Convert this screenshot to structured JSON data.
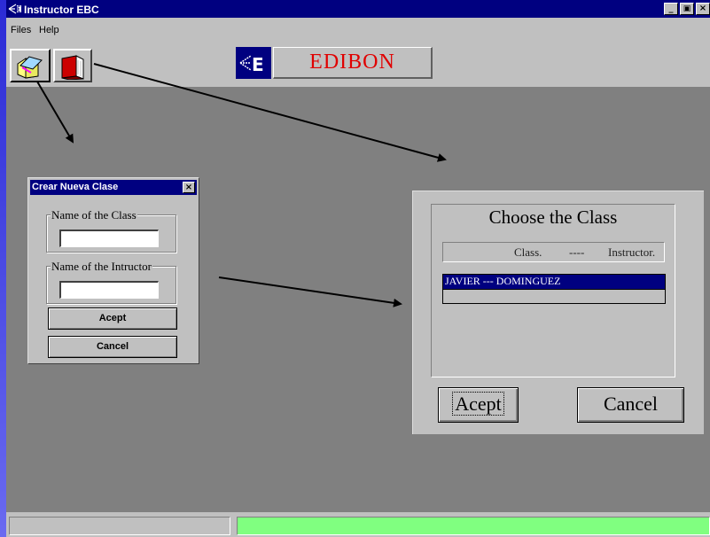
{
  "window": {
    "title": "Instructor EBC",
    "controls": [
      "minimize",
      "maximize",
      "close"
    ]
  },
  "menubar": {
    "items": [
      {
        "label": "Files"
      },
      {
        "label": "Help"
      }
    ]
  },
  "toolbar": {
    "buttons": [
      {
        "name": "new-class-button",
        "icon": "open-folder-icon"
      },
      {
        "name": "choose-class-button",
        "icon": "book-icon"
      }
    ],
    "logo": {
      "text": "EDIBON",
      "mark": "E",
      "text_color": "#e00000",
      "mark_color": "#000080"
    }
  },
  "new_class_dialog": {
    "title": "Crear Nueva Clase",
    "class_label": "Name of the Class",
    "class_value": "",
    "instructor_label": "Name of the Intructor",
    "instructor_value": "",
    "accept_label": "Acept",
    "cancel_label": "Cancel"
  },
  "choose_class_dialog": {
    "title": "Choose the Class",
    "header": {
      "class": "Class.",
      "separator": "----",
      "instructor": "Instructor."
    },
    "items": [
      {
        "label": "JAVIER --- DOMINGUEZ",
        "selected": true
      }
    ],
    "accept_label": "Acept",
    "cancel_label": "Cancel"
  },
  "statusbar": {
    "left_text": "",
    "right_color": "#80ff80"
  },
  "colors": {
    "workspace": "#808080",
    "face": "#c0c0c0",
    "titlebar": "#000080"
  }
}
